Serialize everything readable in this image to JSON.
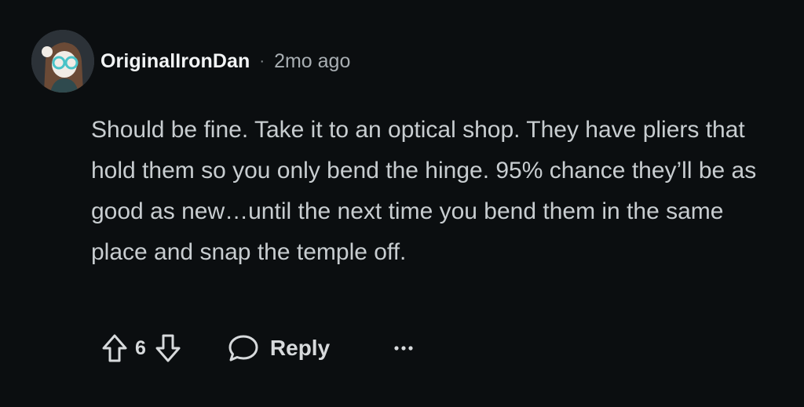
{
  "comment": {
    "author": "OriginalIronDan",
    "separator": "·",
    "timestamp": "2mo ago",
    "body": "Should be fine. Take it to an optical shop. They have pliers that hold them so you only bend the hinge. 95% chance they’ll be as good as new…until the next time you bend them in the same place and snap the temple off.",
    "score": "6",
    "reply_label": "Reply"
  },
  "icons": {
    "upvote": "arrow-up-outline-icon",
    "downvote": "arrow-down-outline-icon",
    "reply": "speech-bubble-icon",
    "more": "ellipsis-icon"
  },
  "colors": {
    "background": "#0b0e10",
    "text": "#c8cdd0",
    "username": "#f2f4f5",
    "muted": "#a8aeb2"
  }
}
